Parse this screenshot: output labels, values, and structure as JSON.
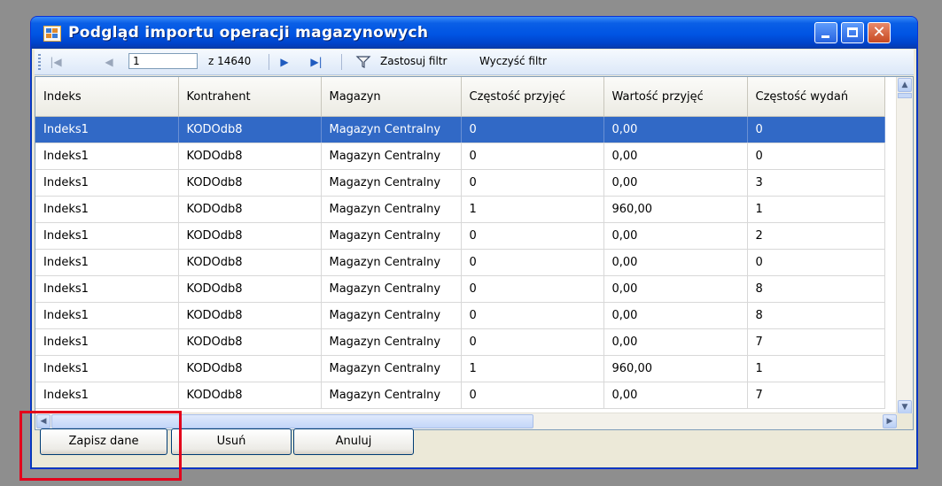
{
  "window": {
    "title": "Podgląd importu operacji magazynowych",
    "accent": "#0054e3"
  },
  "navigator": {
    "position_value": "1",
    "count_label": "z 14640",
    "apply_filter": "Zastosuj filtr",
    "clear_filter": "Wyczyść filtr"
  },
  "grid": {
    "columns": [
      "Indeks",
      "Kontrahent",
      "Magazyn",
      "Częstość przyjęć",
      "Wartość przyjęć",
      "Częstość wydań"
    ],
    "rows": [
      [
        "Indeks1",
        "KODOdb8",
        "Magazyn Centralny",
        "0",
        "0,00",
        "0"
      ],
      [
        "Indeks1",
        "KODOdb8",
        "Magazyn Centralny",
        "0",
        "0,00",
        "0"
      ],
      [
        "Indeks1",
        "KODOdb8",
        "Magazyn Centralny",
        "0",
        "0,00",
        "3"
      ],
      [
        "Indeks1",
        "KODOdb8",
        "Magazyn Centralny",
        "1",
        "960,00",
        "1"
      ],
      [
        "Indeks1",
        "KODOdb8",
        "Magazyn Centralny",
        "0",
        "0,00",
        "2"
      ],
      [
        "Indeks1",
        "KODOdb8",
        "Magazyn Centralny",
        "0",
        "0,00",
        "0"
      ],
      [
        "Indeks1",
        "KODOdb8",
        "Magazyn Centralny",
        "0",
        "0,00",
        "8"
      ],
      [
        "Indeks1",
        "KODOdb8",
        "Magazyn Centralny",
        "0",
        "0,00",
        "8"
      ],
      [
        "Indeks1",
        "KODOdb8",
        "Magazyn Centralny",
        "0",
        "0,00",
        "7"
      ],
      [
        "Indeks1",
        "KODOdb8",
        "Magazyn Centralny",
        "1",
        "960,00",
        "1"
      ],
      [
        "Indeks1",
        "KODOdb8",
        "Magazyn Centralny",
        "0",
        "0,00",
        "7"
      ]
    ],
    "selected_row": 0,
    "selection_color": "#3169c6"
  },
  "buttons": {
    "save": "Zapisz dane",
    "delete": "Usuń",
    "cancel": "Anuluj"
  },
  "annotation": {
    "color": "#e3001b"
  }
}
